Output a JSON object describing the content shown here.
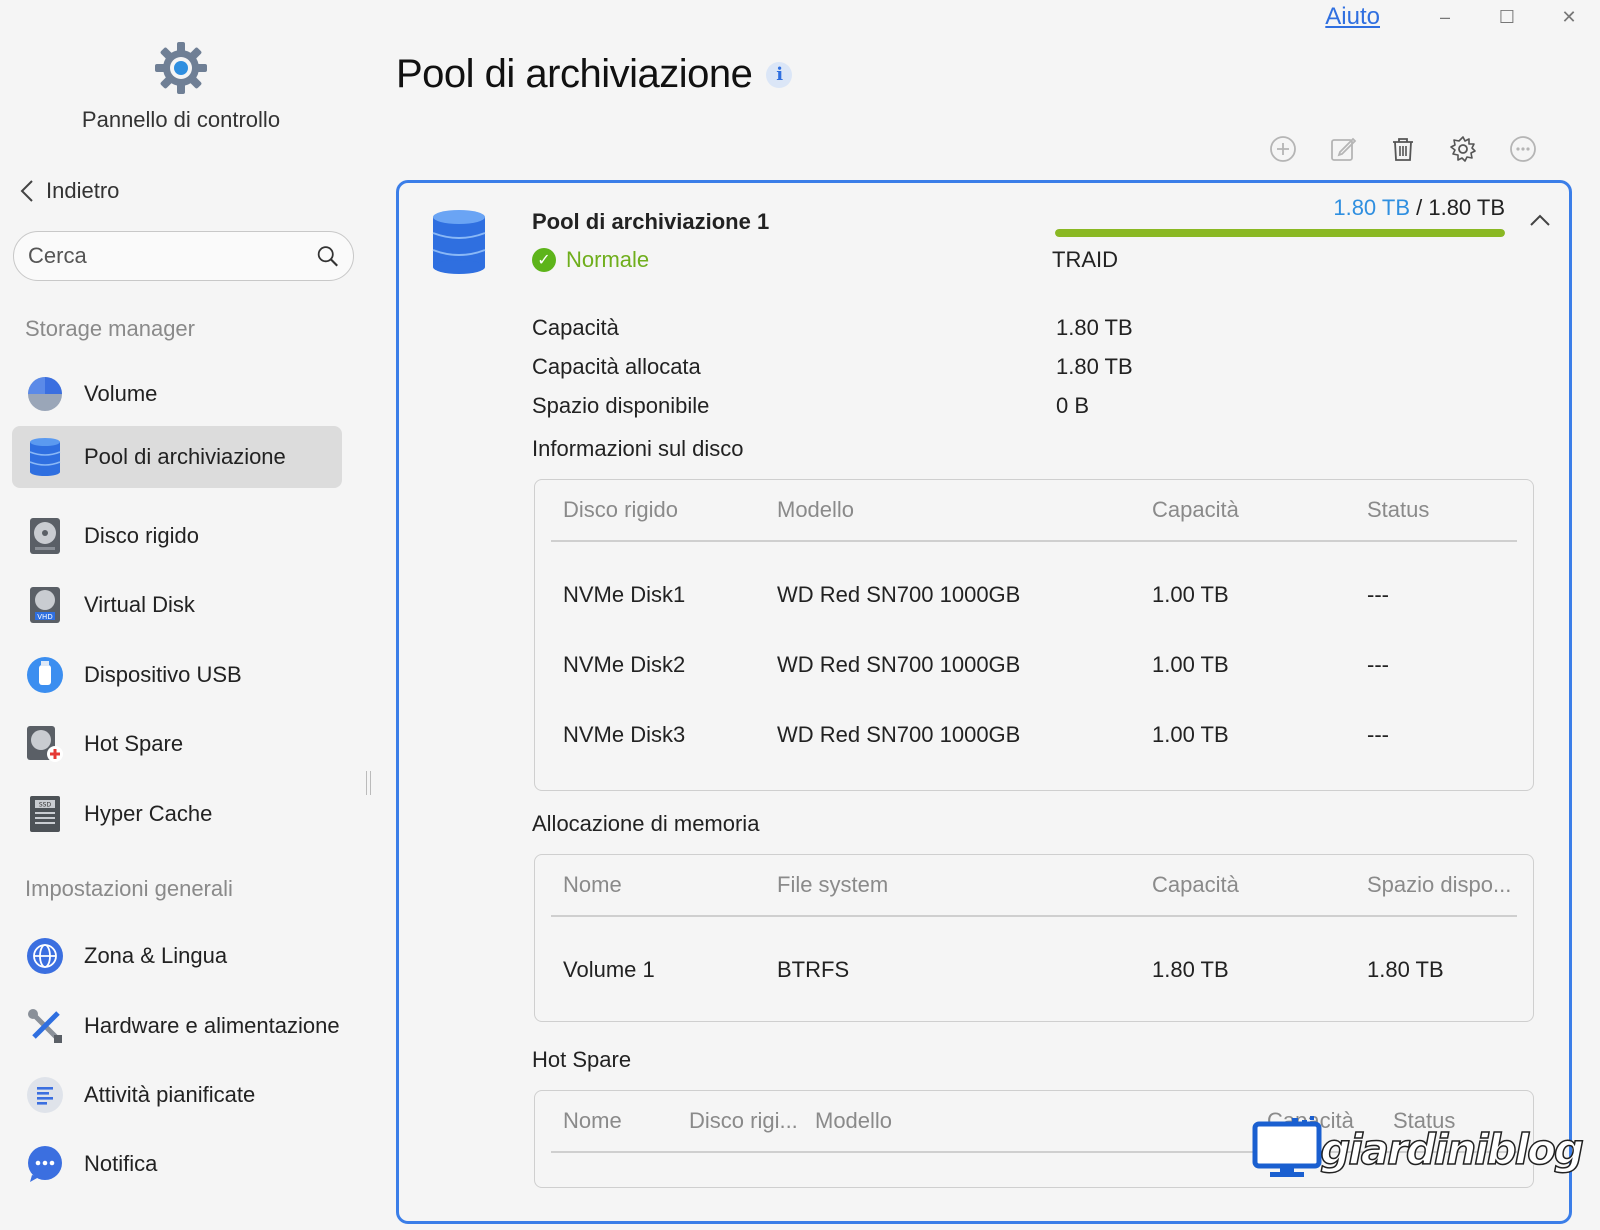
{
  "window": {
    "help_label": "Aiuto",
    "minimize": "–",
    "maximize": "☐",
    "close": "✕"
  },
  "sidebar": {
    "app_name": "Pannello di controllo",
    "back_label": "Indietro",
    "search_placeholder": "Cerca",
    "sections": [
      {
        "label": "Storage manager"
      },
      {
        "label": "Impostazioni generali"
      }
    ],
    "items": [
      {
        "label": "Volume",
        "icon": "volume-pie-icon"
      },
      {
        "label": "Pool di archiviazione",
        "icon": "database-icon",
        "active": true
      },
      {
        "label": "Disco rigido",
        "icon": "hard-disk-icon"
      },
      {
        "label": "Virtual Disk",
        "icon": "virtual-disk-icon"
      },
      {
        "label": "Dispositivo USB",
        "icon": "usb-icon"
      },
      {
        "label": "Hot Spare",
        "icon": "hot-spare-icon"
      },
      {
        "label": "Hyper Cache",
        "icon": "ssd-cache-icon"
      },
      {
        "label": "Zona & Lingua",
        "icon": "globe-icon"
      },
      {
        "label": "Hardware e alimentazione",
        "icon": "tools-icon"
      },
      {
        "label": "Attività pianificate",
        "icon": "tasks-icon"
      },
      {
        "label": "Notifica",
        "icon": "chat-icon"
      }
    ]
  },
  "main": {
    "title": "Pool di archiviazione",
    "info_icon": "i",
    "toolbar": [
      "add-icon",
      "edit-icon",
      "trash-icon",
      "settings-icon",
      "more-icon"
    ],
    "pool": {
      "name": "Pool di archiviazione 1",
      "status": "Normale",
      "used": "1.80 TB",
      "separator": " / ",
      "total": "1.80 TB",
      "usage_fraction": 1.0,
      "raid": "TRAID",
      "details": [
        {
          "label": "Capacità",
          "value": "1.80 TB"
        },
        {
          "label": "Capacità allocata",
          "value": "1.80 TB"
        },
        {
          "label": "Spazio disponibile",
          "value": "0 B"
        }
      ],
      "disk_info": {
        "title": "Informazioni sul disco",
        "headers": [
          "Disco rigido",
          "Modello",
          "Capacità",
          "Status"
        ],
        "rows": [
          [
            "NVMe Disk1",
            "WD Red SN700 1000GB",
            "1.00 TB",
            "---"
          ],
          [
            "NVMe Disk2",
            "WD Red SN700 1000GB",
            "1.00 TB",
            "---"
          ],
          [
            "NVMe Disk3",
            "WD Red SN700 1000GB",
            "1.00 TB",
            "---"
          ]
        ]
      },
      "allocation": {
        "title": "Allocazione di memoria",
        "headers": [
          "Nome",
          "File system",
          "Capacità",
          "Spazio dispo..."
        ],
        "rows": [
          [
            "Volume 1",
            "BTRFS",
            "1.80 TB",
            "1.80 TB"
          ]
        ]
      },
      "hot_spare": {
        "title": "Hot Spare",
        "headers": [
          "Nome",
          "Disco rigi...",
          "Modello",
          "Capacità",
          "Status"
        ]
      }
    }
  },
  "watermark": "giardiniblog",
  "colors": {
    "accent": "#3b7ee8",
    "status_ok": "#5db41a",
    "usage_bar": "#8ab823"
  }
}
